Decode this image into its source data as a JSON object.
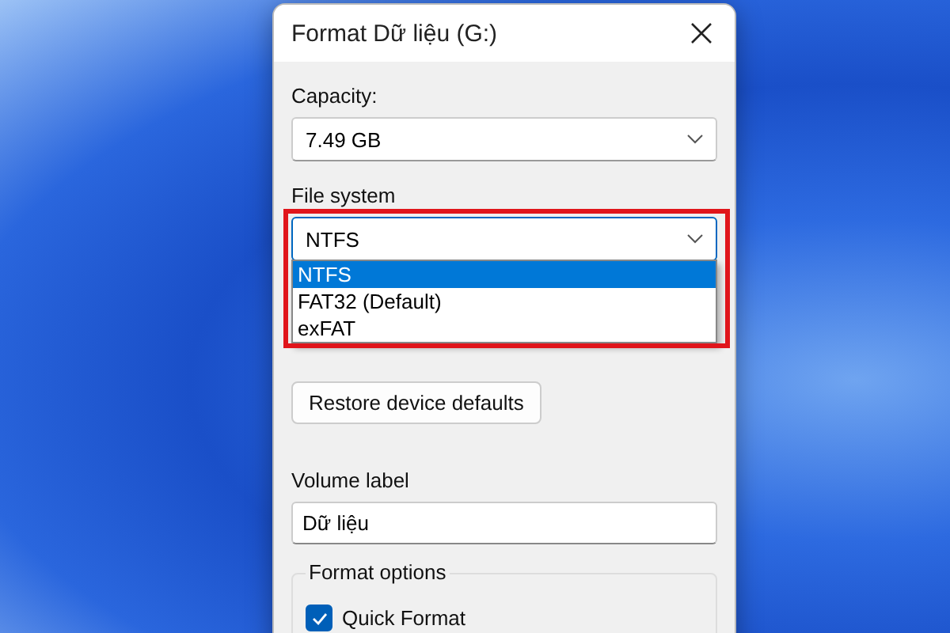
{
  "window": {
    "title": "Format Dữ liệu (G:)"
  },
  "capacity": {
    "label": "Capacity:",
    "value": "7.49 GB"
  },
  "file_system": {
    "label": "File system",
    "value": "NTFS",
    "expanded": true,
    "options": [
      {
        "label": "NTFS",
        "selected": true
      },
      {
        "label": "FAT32 (Default)",
        "selected": false
      },
      {
        "label": "exFAT",
        "selected": false
      }
    ]
  },
  "restore_button": "Restore device defaults",
  "volume_label": {
    "label": "Volume label",
    "value": "Dữ liệu"
  },
  "format_options": {
    "title": "Format options",
    "quick_format": {
      "label": "Quick Format",
      "checked": true
    }
  }
}
